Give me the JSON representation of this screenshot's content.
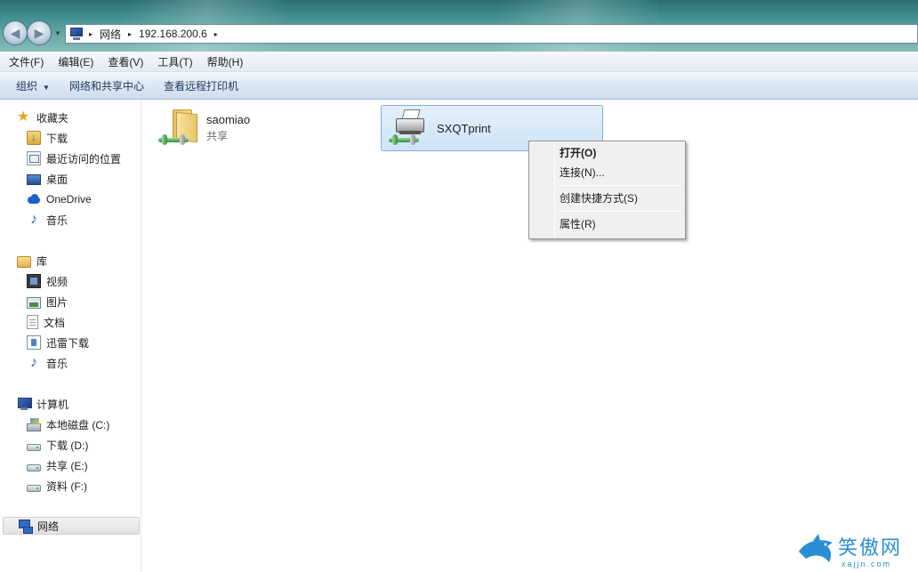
{
  "address": {
    "crumbs": [
      "网络",
      "192.168.200.6"
    ],
    "sep": "▸"
  },
  "menubar": {
    "items": [
      "文件(F)",
      "编辑(E)",
      "查看(V)",
      "工具(T)",
      "帮助(H)"
    ]
  },
  "cmdbar": {
    "organize": "组织",
    "network_center": "网络和共享中心",
    "remote_printers": "查看远程打印机"
  },
  "nav": {
    "favorites": {
      "label": "收藏夹",
      "items": [
        "下载",
        "最近访问的位置",
        "桌面",
        "OneDrive",
        "音乐"
      ]
    },
    "libraries": {
      "label": "库",
      "items": [
        "视频",
        "图片",
        "文档",
        "迅雷下载",
        "音乐"
      ]
    },
    "computer": {
      "label": "计算机",
      "items": [
        "本地磁盘 (C:)",
        "下载 (D:)",
        "共享 (E:)",
        "资料 (F:)"
      ]
    },
    "network": {
      "label": "网络"
    }
  },
  "content": {
    "items": [
      {
        "name": "saomiao",
        "sub": "共享"
      },
      {
        "name": "SXQTprint",
        "sub": ""
      }
    ]
  },
  "context_menu": {
    "items": [
      "打开(O)",
      "连接(N)...",
      "创建快捷方式(S)",
      "属性(R)"
    ]
  },
  "watermark": {
    "text": "笑傲网",
    "sub": "xajjn.com"
  },
  "colors": {
    "selection": "#cde4f7",
    "selection_border": "#84acdd",
    "accent": "#2a8ed6"
  }
}
